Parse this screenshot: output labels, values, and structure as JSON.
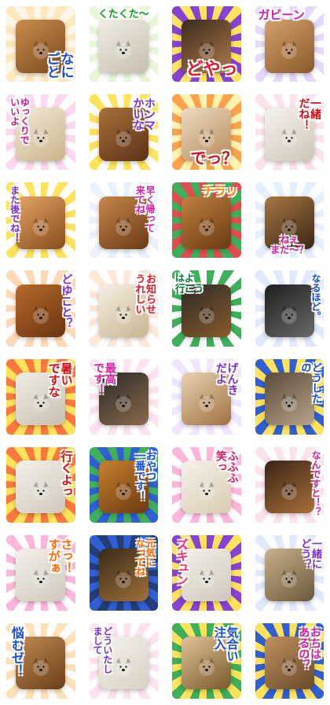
{
  "stickers": [
    {
      "caption": "なに\nごと",
      "color": "#1a4fd1",
      "style": "vert",
      "pos": "br",
      "size": 17,
      "bg1": "#fde7b6",
      "bg2": "#fef7e6",
      "p1": "#c98d4a",
      "p2": "#7a4a22"
    },
    {
      "caption": "くたくた〜",
      "color": "#1a9a2a",
      "style": "",
      "pos": "tc",
      "size": 13,
      "bg1": "#e7f7d4",
      "bg2": "#ffffff",
      "p1": "#f1ede4",
      "p2": "#c7bfae"
    },
    {
      "caption": "どやっ",
      "color": "#e01a2a",
      "style": "",
      "pos": "br",
      "size": 22,
      "bg1": "#7a2fd0",
      "bg2": "#ffe14a",
      "p1": "#3a2a1f",
      "p2": "#b07a48"
    },
    {
      "caption": "ガビーン",
      "color": "#d41fa0",
      "style": "",
      "pos": "tl",
      "size": 15,
      "bg1": "#e5d6ff",
      "bg2": "#ffffff",
      "p1": "#d4a06a",
      "p2": "#8a5a2a"
    },
    {
      "caption": "ゆっくりで\nいいよ",
      "color": "#c0208a",
      "style": "vert",
      "pos": "tl",
      "size": 12,
      "bg1": "#ffd6ee",
      "bg2": "#ffffff",
      "p1": "#f3ead9",
      "p2": "#c9b48a"
    },
    {
      "caption": "ホンマ\nかいな",
      "color": "#7a2fd0",
      "style": "vert",
      "pos": "tr",
      "size": 14,
      "bg1": "#ffe14a",
      "bg2": "#ffffff",
      "p1": "#a8703a",
      "p2": "#5b3316"
    },
    {
      "caption": "でっ？",
      "color": "#d0101a",
      "style": "",
      "pos": "br",
      "size": 20,
      "bg1": "#ff9a3a",
      "bg2": "#fff3a8",
      "p1": "#ecdcc4",
      "p2": "#b88a58"
    },
    {
      "caption": "一緒\nだね！",
      "color": "#d0101a",
      "style": "vert",
      "pos": "tr",
      "size": 14,
      "bg1": "#ffe0ea",
      "bg2": "#ffffff",
      "p1": "#f6f2ec",
      "p2": "#cfc6b8"
    },
    {
      "caption": "また後でね！",
      "color": "#7a2fd0",
      "style": "vert",
      "pos": "tl",
      "size": 12,
      "bg1": "#ffe14a",
      "bg2": "#ffffff",
      "p1": "#e2a464",
      "p2": "#8a4c1c"
    },
    {
      "caption": "早く帰って\n来てね",
      "color": "#d41fa0",
      "style": "vert",
      "pos": "tr",
      "size": 12,
      "bg1": "#e9f2ff",
      "bg2": "#ffffff",
      "p1": "#c6874a",
      "p2": "#6a3a16"
    },
    {
      "caption": "チラッ",
      "color": "#ff8a00",
      "style": "",
      "pos": "tr",
      "size": 15,
      "bg1": "#2aa84a",
      "bg2": "#e13a3a",
      "p1": "#c08040",
      "p2": "#6a3a12"
    },
    {
      "caption": "ねぇ\nまだ〜？",
      "color": "#d41fa0",
      "style": "",
      "pos": "bc",
      "size": 12,
      "bg1": "#e3f0ff",
      "bg2": "#ffffff",
      "p1": "#a87840",
      "p2": "#3a2616"
    },
    {
      "caption": "どゆこと？",
      "color": "#7a2fd0",
      "style": "vert",
      "pos": "tr",
      "size": 14,
      "bg1": "#ffd6b0",
      "bg2": "#ffffff",
      "p1": "#b86a2a",
      "p2": "#6a3410"
    },
    {
      "caption": "お知らせ\nうれしい",
      "color": "#e01a2a",
      "style": "vert",
      "pos": "tr",
      "size": 13,
      "bg1": "#ffe8d6",
      "bg2": "#ffffff",
      "p1": "#f6efe4",
      "p2": "#c8b48e"
    },
    {
      "caption": "はよ\n行こう",
      "color": "#0c7a3a",
      "style": "",
      "pos": "tl",
      "size": 12,
      "bg1": "#2aa84a",
      "bg2": "#ffffff",
      "p1": "#2a2a2a",
      "p2": "#8a5a2a"
    },
    {
      "caption": "なるほど。",
      "color": "#1a4fd1",
      "style": "vert",
      "pos": "tr",
      "size": 12,
      "bg1": "#dfe8ff",
      "bg2": "#ffffff",
      "p1": "#1e1e1e",
      "p2": "#6a6a6a"
    },
    {
      "caption": "暑い\nですな",
      "color": "#d0101a",
      "style": "vert",
      "pos": "tr",
      "size": 15,
      "bg1": "#ff6a2a",
      "bg2": "#ffe14a",
      "p1": "#f0ede6",
      "p2": "#c8c0b0"
    },
    {
      "caption": "最高\nです！",
      "color": "#d41fa0",
      "style": "vert",
      "pos": "tl",
      "size": 14,
      "bg1": "#ffe0f0",
      "bg2": "#ffffff",
      "p1": "#2a2a2a",
      "p2": "#8a6a4a"
    },
    {
      "caption": "げんき\nだよ",
      "color": "#7a2fd0",
      "style": "vert",
      "pos": "tr",
      "size": 14,
      "bg1": "#f0e6ff",
      "bg2": "#ffffff",
      "p1": "#e9d3b2",
      "p2": "#a07040"
    },
    {
      "caption": "どうした\nの",
      "color": "#1a4fd1",
      "style": "vert",
      "pos": "tr",
      "size": 13,
      "bg1": "#1a4fd1",
      "bg2": "#ffe14a",
      "p1": "#5a4a3a",
      "p2": "#b8a48a"
    },
    {
      "caption": "行くよっ",
      "color": "#d0101a",
      "style": "vert",
      "pos": "tr",
      "size": 15,
      "bg1": "#ff6a2a",
      "bg2": "#ffe14a",
      "p1": "#f4f1ea",
      "p2": "#cfc8bb"
    },
    {
      "caption": "おやつ\n一番です！",
      "color": "#1a4fd1",
      "style": "vert",
      "pos": "tr",
      "size": 13,
      "bg1": "#2aa84a",
      "bg2": "#1a4fd1",
      "p1": "#c8802e",
      "p2": "#6a3a12"
    },
    {
      "caption": "ふふふ\n笑っ",
      "color": "#e01a6a",
      "style": "vert",
      "pos": "tr",
      "size": 14,
      "bg1": "#ffb0d8",
      "bg2": "#ffffff",
      "p1": "#f6f2ea",
      "p2": "#d8cbb0"
    },
    {
      "caption": "なんですと！？",
      "color": "#d41fa0",
      "style": "vert",
      "pos": "tr",
      "size": 12,
      "bg1": "#ffe0ea",
      "bg2": "#ffffff",
      "p1": "#3a2416",
      "p2": "#a8703a"
    },
    {
      "caption": "さっ！\nすがぁ",
      "color": "#ff6a00",
      "style": "vert",
      "pos": "tr",
      "size": 15,
      "bg1": "#ffb0d8",
      "bg2": "#ffffff",
      "p1": "#f4f1ea",
      "p2": "#cfc8bb"
    },
    {
      "caption": "元気に\nなってね",
      "color": "#ff6a00",
      "style": "vert",
      "pos": "tr",
      "size": 12,
      "bg1": "#1a4fd1",
      "bg2": "#0c2a6a",
      "p1": "#3a2a1a",
      "p2": "#a0703a"
    },
    {
      "caption": "ズキュン",
      "color": "#ff2a6a",
      "style": "vert",
      "pos": "tl",
      "size": 15,
      "bg1": "#7a2fd0",
      "bg2": "#ffe14a",
      "p1": "#f4f1ea",
      "p2": "#cfc8bb"
    },
    {
      "caption": "一緒に\nどう？",
      "color": "#7a2fd0",
      "style": "vert",
      "pos": "tr",
      "size": 13,
      "bg1": "#dfe8ff",
      "bg2": "#ffffff",
      "p1": "#c8b08a",
      "p2": "#6a5a3a"
    },
    {
      "caption": "悩むゼ！",
      "color": "#1a4fd1",
      "style": "vert",
      "pos": "tl",
      "size": 16,
      "bg1": "#ffe0b0",
      "bg2": "#ffffff",
      "p1": "#c08a54",
      "p2": "#6a4018"
    },
    {
      "caption": "どういたし\nまして",
      "color": "#7a2fd0",
      "style": "vert",
      "pos": "tl",
      "size": 12,
      "bg1": "#ffe0f0",
      "bg2": "#ffffff",
      "p1": "#f6f2ec",
      "p2": "#d8d0c4"
    },
    {
      "caption": "気合い\n注入",
      "color": "#1a4fd1",
      "style": "vert",
      "pos": "tr",
      "size": 15,
      "bg1": "#2aa84a",
      "bg2": "#ffe14a",
      "p1": "#e2c298",
      "p2": "#7a5a2a"
    },
    {
      "caption": "おちは\nあるの？",
      "color": "#d41fa0",
      "style": "vert",
      "pos": "tr",
      "size": 14,
      "bg1": "#ffe14a",
      "bg2": "#1a4fd1",
      "p1": "#c09060",
      "p2": "#6a4a28"
    }
  ]
}
